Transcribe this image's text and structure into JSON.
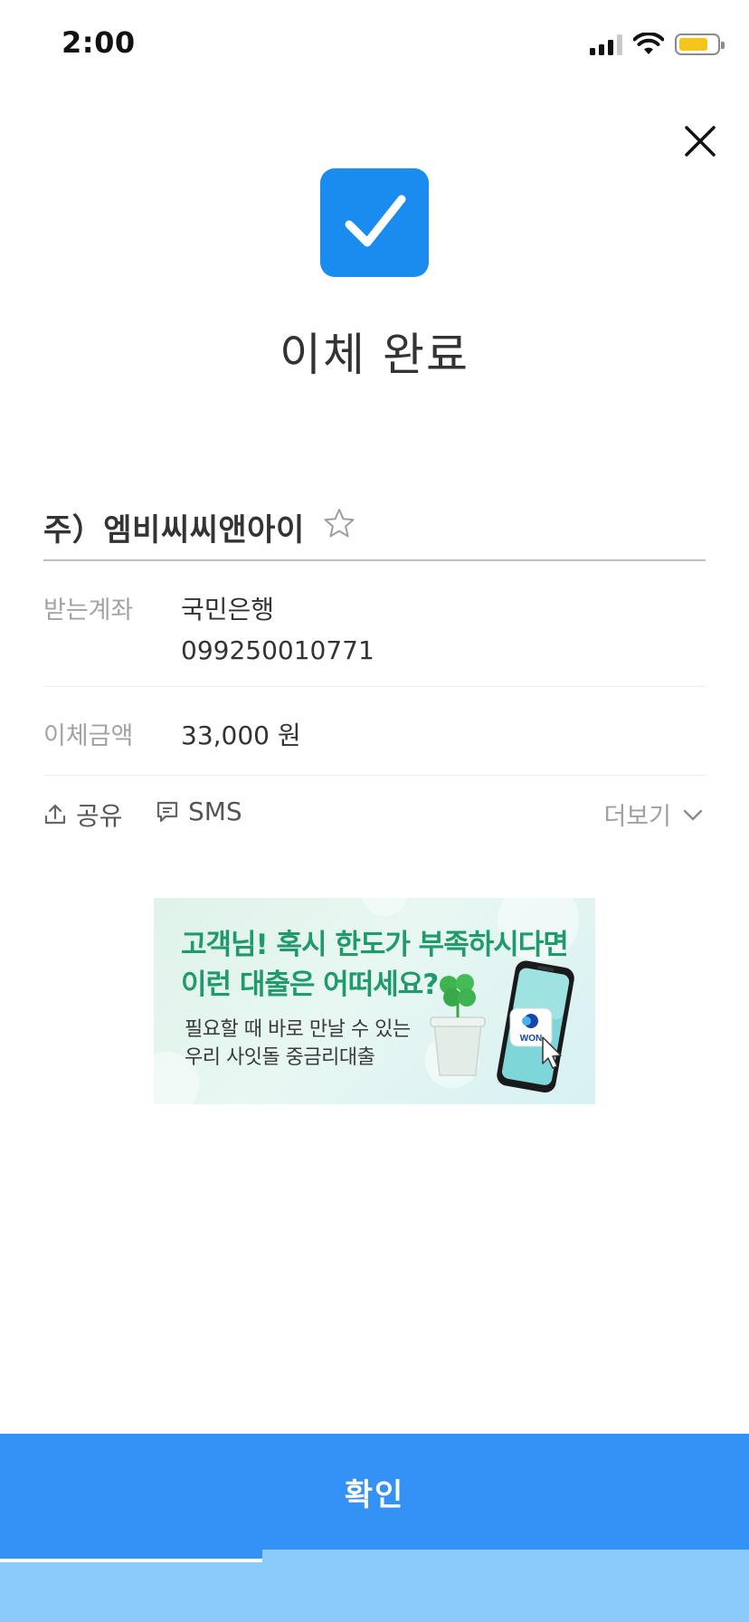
{
  "status_bar": {
    "time": "2:00",
    "battery_color": "#f5c518"
  },
  "header": {
    "title": "이체 완료",
    "accent": "#1a8cf0"
  },
  "payee": {
    "name": "주）엠비씨씨앤아이"
  },
  "details": {
    "account_label": "받는계좌",
    "bank": "국민은행",
    "account_number": "099250010771",
    "amount_label": "이체금액",
    "amount": "33,000 원"
  },
  "actions": {
    "share": "공유",
    "sms": "SMS",
    "more": "더보기"
  },
  "banner": {
    "headline_1": "고객님! 혹시 한도가 부족하시다면",
    "headline_2": "이런 대출은 어떠세요?",
    "sub_1": "필요할 때 바로 만날 수 있는",
    "sub_2": "우리 사잇돌 중금리대출",
    "app_badge": "WON"
  },
  "confirm": {
    "label": "확인",
    "color": "#3491f5"
  },
  "progress": {
    "fraction": 0.35
  }
}
